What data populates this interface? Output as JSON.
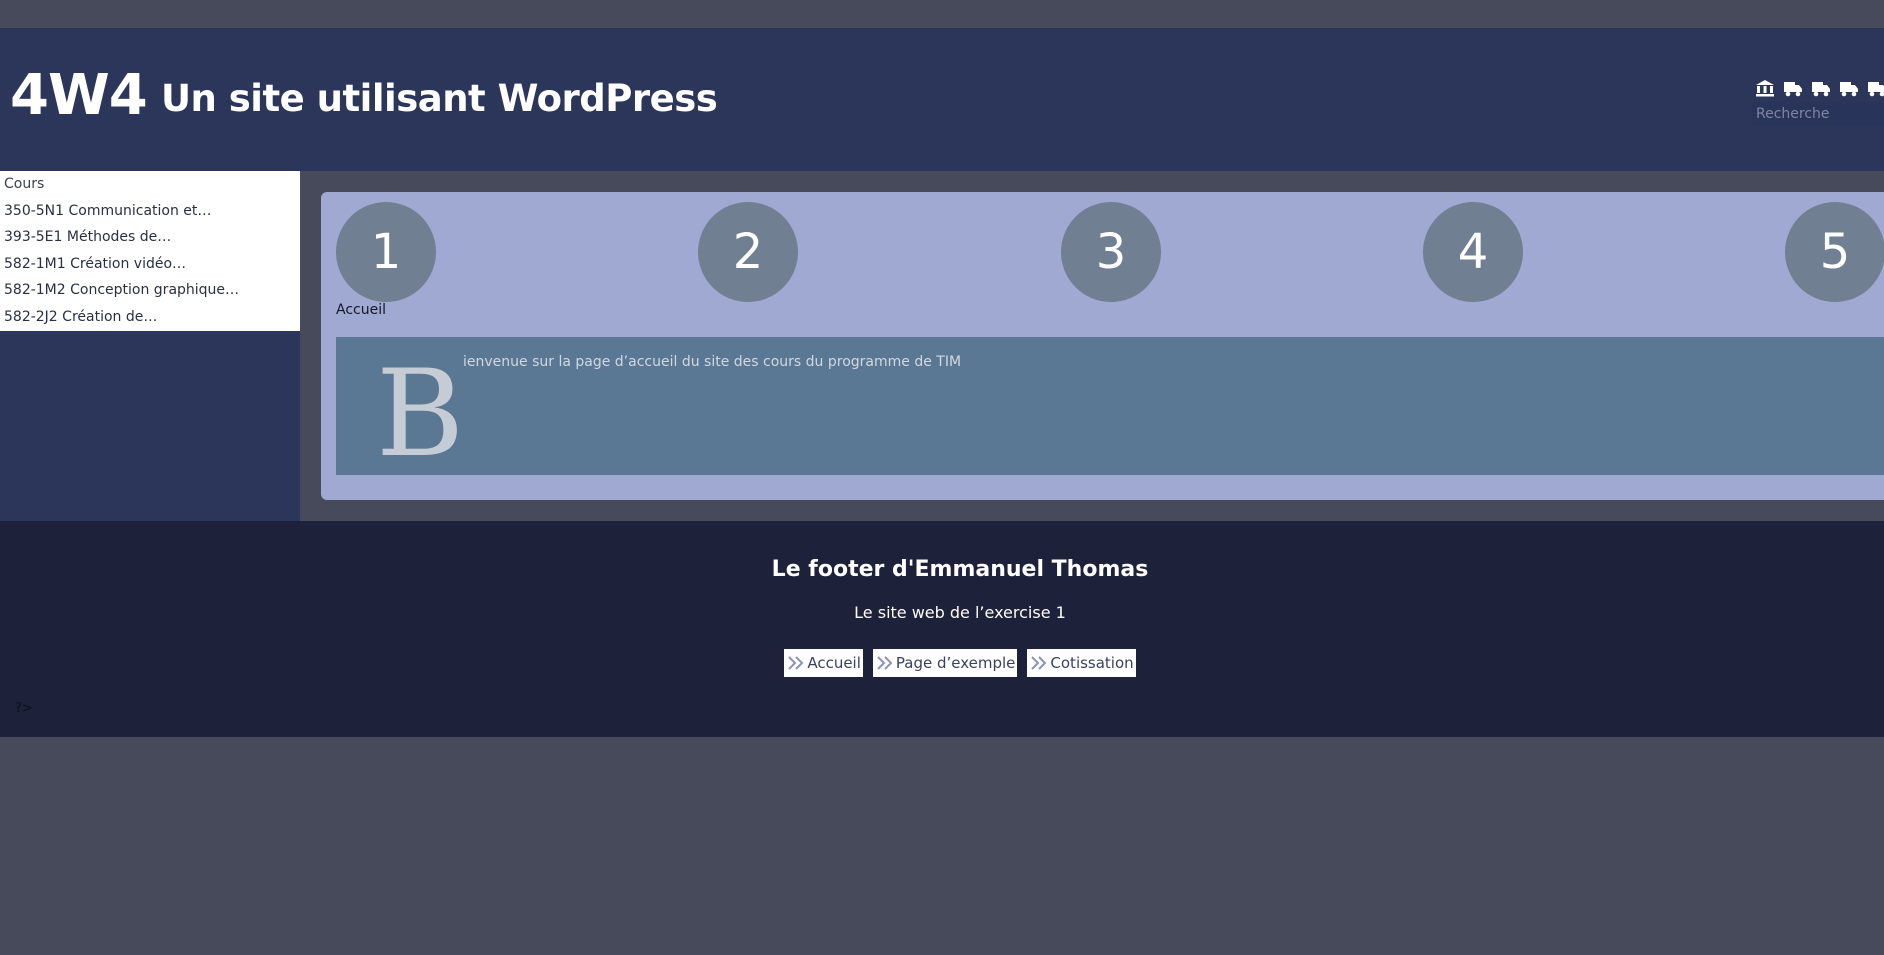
{
  "header": {
    "logo": "4W4",
    "title": "Un site utilisant WordPress",
    "icons": [
      "bank-icon",
      "truck-icon",
      "truck-icon",
      "truck-icon",
      "truck-icon"
    ],
    "search_placeholder": "Recherche"
  },
  "sidebar": {
    "items": [
      {
        "label": "Cours"
      },
      {
        "label": "350-5N1 Communication et…"
      },
      {
        "label": "393-5E1 Méthodes de…"
      },
      {
        "label": "582-1M1 Création vidéo…"
      },
      {
        "label": "582-1M2 Conception graphique…"
      },
      {
        "label": "582-2J2 Création de…"
      }
    ]
  },
  "main": {
    "circles": [
      "1",
      "2",
      "3",
      "4",
      "5"
    ],
    "home_label": "Accueil",
    "welcome_drop": "B",
    "welcome_text": "ienvenue sur la page d’accueil du site des cours du programme de TIM"
  },
  "footer": {
    "title": "Le footer d'Emmanuel Thomas",
    "subtitle": "Le site web de l’exercise 1",
    "links": [
      {
        "label": "Accueil"
      },
      {
        "label": "Page d’exemple"
      },
      {
        "label": "Cotissation"
      }
    ],
    "php_tag": "?>"
  },
  "colors": {
    "page_bg": "#474a5a",
    "header_bg": "#2b365a",
    "main_box_bg": "#9fa9d1",
    "circle_bg": "#717f92",
    "welcome_bg": "#5a7793",
    "footer_bg": "#1d2139"
  }
}
